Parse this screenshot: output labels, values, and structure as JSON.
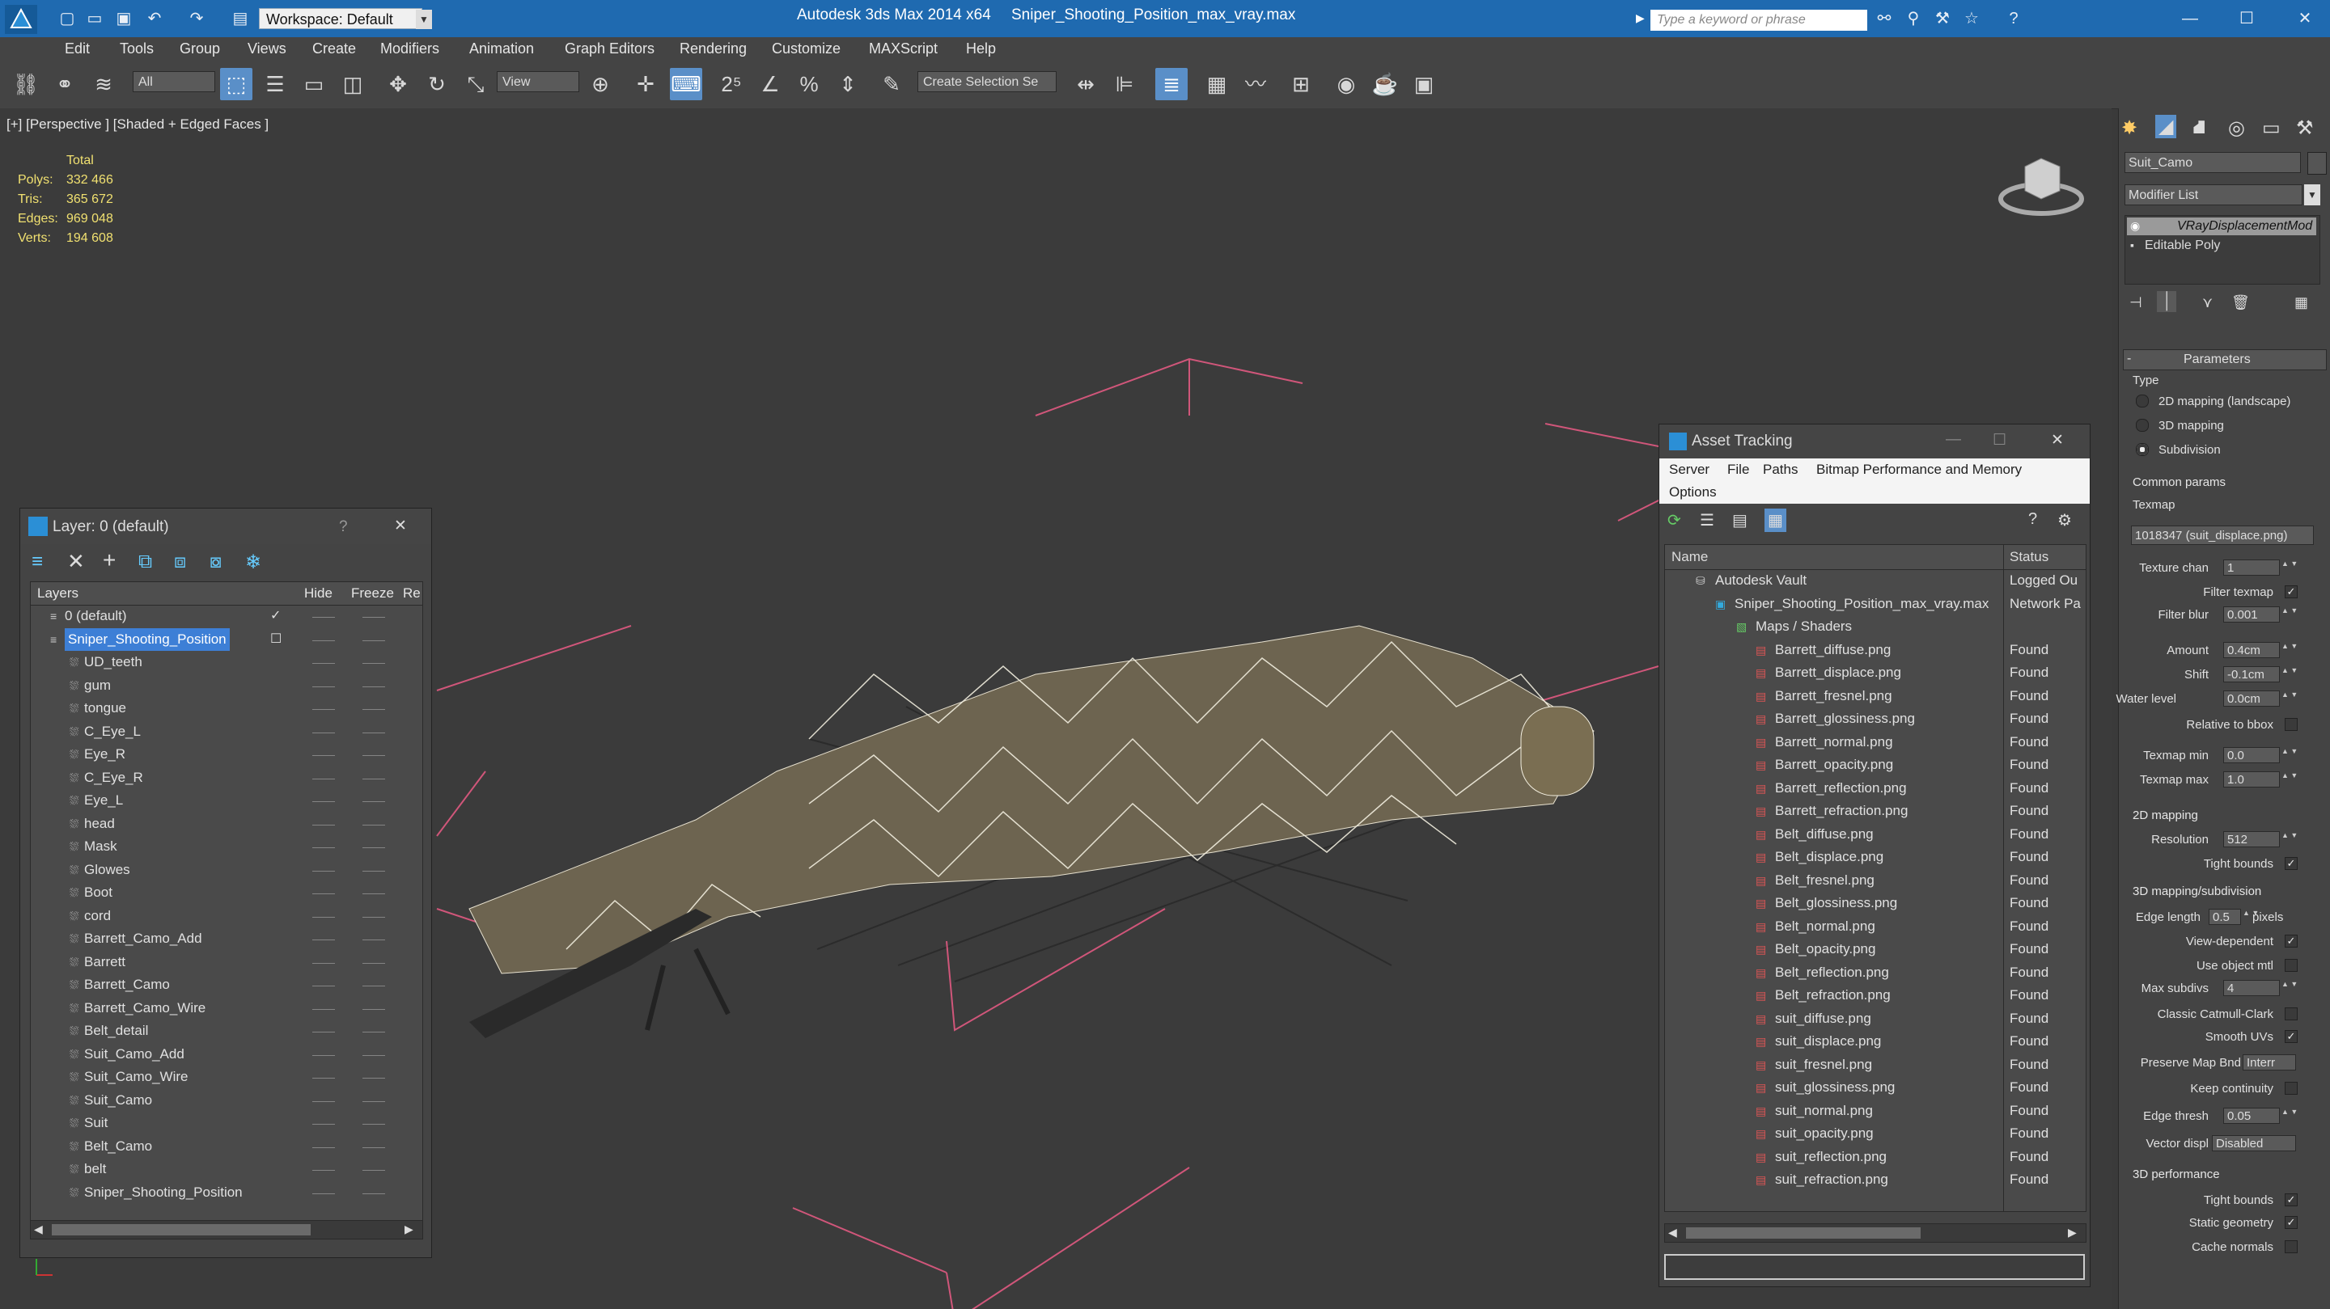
{
  "titlebar": {
    "app_title": "Autodesk 3ds Max  2014 x64",
    "file_name": "Sniper_Shooting_Position_max_vray.max",
    "workspace": "Workspace: Default",
    "search_placeholder": "Type a keyword or phrase"
  },
  "menu": [
    "Edit",
    "Tools",
    "Group",
    "Views",
    "Create",
    "Modifiers",
    "Animation",
    "Graph Editors",
    "Rendering",
    "Customize",
    "MAXScript",
    "Help"
  ],
  "toolbar": {
    "filter_select": "All",
    "ref_coord_select": "View",
    "selection_set": "Create Selection Se"
  },
  "viewport": {
    "label": "[+] [Perspective ] [Shaded + Edged Faces ]",
    "stats_header": "Total",
    "stats": [
      {
        "label": "Polys:",
        "value": "332 466"
      },
      {
        "label": "Tris:",
        "value": "365 672"
      },
      {
        "label": "Edges:",
        "value": "969 048"
      },
      {
        "label": "Verts:",
        "value": "194 608"
      }
    ]
  },
  "layer_window": {
    "title": "Layer: 0 (default)",
    "help": "?",
    "columns": {
      "layers": "Layers",
      "hide": "Hide",
      "freeze": "Freeze",
      "render": "Re"
    },
    "default_layer": "0 (default)",
    "selected_layer": "Sniper_Shooting_Position",
    "items": [
      "UD_teeth",
      "gum",
      "tongue",
      "C_Eye_L",
      "Eye_R",
      "C_Eye_R",
      "Eye_L",
      "head",
      "Mask",
      "Glowes",
      "Boot",
      "cord",
      "Barrett_Camo_Add",
      "Barrett",
      "Barrett_Camo",
      "Barrett_Camo_Wire",
      "Belt_detail",
      "Suit_Camo_Add",
      "Suit_Camo_Wire",
      "Suit_Camo",
      "Suit",
      "Belt_Camo",
      "belt",
      "Sniper_Shooting_Position"
    ]
  },
  "asset_tracking": {
    "title": "Asset Tracking",
    "menu": [
      "Server",
      "File",
      "Paths",
      "Bitmap Performance and Memory",
      "Options"
    ],
    "columns": {
      "name": "Name",
      "status": "Status"
    },
    "vault": {
      "name": "Autodesk Vault",
      "status": "Logged Ou"
    },
    "file": {
      "name": "Sniper_Shooting_Position_max_vray.max",
      "status": "Network Pa"
    },
    "maps_group": "Maps / Shaders",
    "maps": [
      {
        "name": "Barrett_diffuse.png",
        "status": "Found"
      },
      {
        "name": "Barrett_displace.png",
        "status": "Found"
      },
      {
        "name": "Barrett_fresnel.png",
        "status": "Found"
      },
      {
        "name": "Barrett_glossiness.png",
        "status": "Found"
      },
      {
        "name": "Barrett_normal.png",
        "status": "Found"
      },
      {
        "name": "Barrett_opacity.png",
        "status": "Found"
      },
      {
        "name": "Barrett_reflection.png",
        "status": "Found"
      },
      {
        "name": "Barrett_refraction.png",
        "status": "Found"
      },
      {
        "name": "Belt_diffuse.png",
        "status": "Found"
      },
      {
        "name": "Belt_displace.png",
        "status": "Found"
      },
      {
        "name": "Belt_fresnel.png",
        "status": "Found"
      },
      {
        "name": "Belt_glossiness.png",
        "status": "Found"
      },
      {
        "name": "Belt_normal.png",
        "status": "Found"
      },
      {
        "name": "Belt_opacity.png",
        "status": "Found"
      },
      {
        "name": "Belt_reflection.png",
        "status": "Found"
      },
      {
        "name": "Belt_refraction.png",
        "status": "Found"
      },
      {
        "name": "suit_diffuse.png",
        "status": "Found"
      },
      {
        "name": "suit_displace.png",
        "status": "Found"
      },
      {
        "name": "suit_fresnel.png",
        "status": "Found"
      },
      {
        "name": "suit_glossiness.png",
        "status": "Found"
      },
      {
        "name": "suit_normal.png",
        "status": "Found"
      },
      {
        "name": "suit_opacity.png",
        "status": "Found"
      },
      {
        "name": "suit_reflection.png",
        "status": "Found"
      },
      {
        "name": "suit_refraction.png",
        "status": "Found"
      }
    ]
  },
  "command_panel": {
    "object_name": "Suit_Camo",
    "modifier_list": "Modifier List",
    "stack": [
      "VRayDisplacementMod",
      "Editable Poly"
    ],
    "rollout_title": "Parameters",
    "type_label": "Type",
    "type_options": [
      "2D mapping (landscape)",
      "3D mapping",
      "Subdivision"
    ],
    "type_selected": "Subdivision",
    "common_params": "Common params",
    "texmap_label": "Texmap",
    "texmap_value": "1018347 (suit_displace.png)",
    "texture_chan": {
      "label": "Texture chan",
      "value": "1"
    },
    "filter_texmap": {
      "label": "Filter texmap",
      "checked": true
    },
    "filter_blur": {
      "label": "Filter blur",
      "value": "0.001"
    },
    "amount": {
      "label": "Amount",
      "value": "0.4cm"
    },
    "shift": {
      "label": "Shift",
      "value": "-0.1cm"
    },
    "water_level": {
      "label": "Water level",
      "value": "0.0cm"
    },
    "relative_bbox": {
      "label": "Relative to bbox",
      "checked": false
    },
    "texmap_min": {
      "label": "Texmap min",
      "value": "0.0"
    },
    "texmap_max": {
      "label": "Texmap max",
      "value": "1.0"
    },
    "mapping_2d": "2D mapping",
    "resolution": {
      "label": "Resolution",
      "value": "512"
    },
    "tight_bounds_2d": {
      "label": "Tight bounds",
      "checked": true
    },
    "mapping_3d": "3D mapping/subdivision",
    "edge_length": {
      "label": "Edge length",
      "value": "0.5",
      "unit": "pixels"
    },
    "view_dependent": {
      "label": "View-dependent",
      "checked": true
    },
    "use_object_mtl": {
      "label": "Use object mtl",
      "checked": false
    },
    "max_subdivs": {
      "label": "Max subdivs",
      "value": "4"
    },
    "classic_catmull": {
      "label": "Classic Catmull-Clark",
      "checked": false
    },
    "smooth_uvs": {
      "label": "Smooth UVs",
      "checked": true
    },
    "preserve_map": {
      "label": "Preserve Map Bnd",
      "value": "Interr"
    },
    "keep_continuity": {
      "label": "Keep continuity",
      "checked": false
    },
    "edge_thresh": {
      "label": "Edge thresh",
      "value": "0.05"
    },
    "vector_displ": {
      "label": "Vector displ",
      "value": "Disabled"
    },
    "performance": "3D performance",
    "tight_bounds": {
      "label": "Tight bounds",
      "checked": true
    },
    "static_geometry": {
      "label": "Static geometry",
      "checked": true
    },
    "cache_normals": {
      "label": "Cache normals",
      "checked": false
    }
  }
}
